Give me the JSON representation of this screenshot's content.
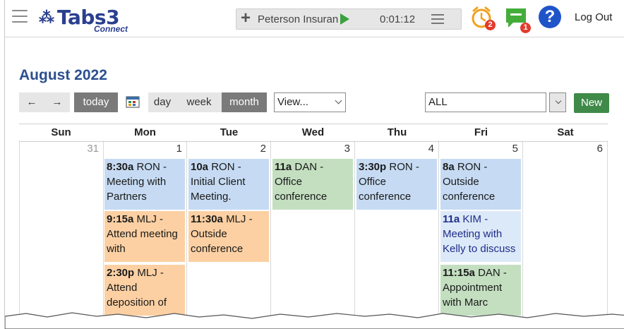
{
  "app": {
    "logo_text": "Tabs3",
    "logo_sub": "Connect"
  },
  "timer": {
    "client": "Peterson Insuranc",
    "elapsed": "0:01:12"
  },
  "header": {
    "alarm_count": "2",
    "message_count": "1",
    "help_label": "?",
    "logout_label": "Log Out"
  },
  "calendar": {
    "title": "August 2022",
    "toolbar": {
      "prev": "←",
      "next": "→",
      "today": "today",
      "day": "day",
      "week": "week",
      "month": "month",
      "view_selected": "View...",
      "filter_selected": "ALL",
      "new_label": "New"
    },
    "days": [
      "Sun",
      "Mon",
      "Tue",
      "Wed",
      "Thu",
      "Fri",
      "Sat"
    ],
    "dates": [
      "31",
      "1",
      "2",
      "3",
      "4",
      "5",
      "6"
    ],
    "events": {
      "mon": [
        {
          "time": "8:30a",
          "text": "RON - Meeting with Partners",
          "color": "blue"
        },
        {
          "time": "9:15a",
          "text": "MLJ - Attend meeting with",
          "color": "orange"
        },
        {
          "time": "2:30p",
          "text": "MLJ - Attend deposition of",
          "color": "orange"
        }
      ],
      "tue": [
        {
          "time": "10a",
          "text": "RON - Initial Client Meeting.",
          "color": "blue"
        },
        {
          "time": "11:30a",
          "text": "MLJ - Outside conference",
          "color": "orange"
        }
      ],
      "wed": [
        {
          "time": "11a",
          "text": "DAN - Office conference",
          "color": "green"
        }
      ],
      "thu": [
        {
          "time": "3:30p",
          "text": "RON - Office conference",
          "color": "blue"
        }
      ],
      "fri": [
        {
          "time": "8a",
          "text": "RON - Outside conference",
          "color": "blue"
        },
        {
          "time": "11a",
          "text": "KIM - Meeting with Kelly to discuss",
          "color": "white"
        },
        {
          "time": "11:15a",
          "text": "DAN - Appointment with Marc",
          "color": "green"
        }
      ]
    }
  },
  "colors": {
    "accent_blue": "#2b4f8f",
    "event_blue": "#c6dbf3",
    "event_orange": "#fcd0a3",
    "event_green": "#c3dfc0",
    "new_button": "#3f8a49"
  }
}
